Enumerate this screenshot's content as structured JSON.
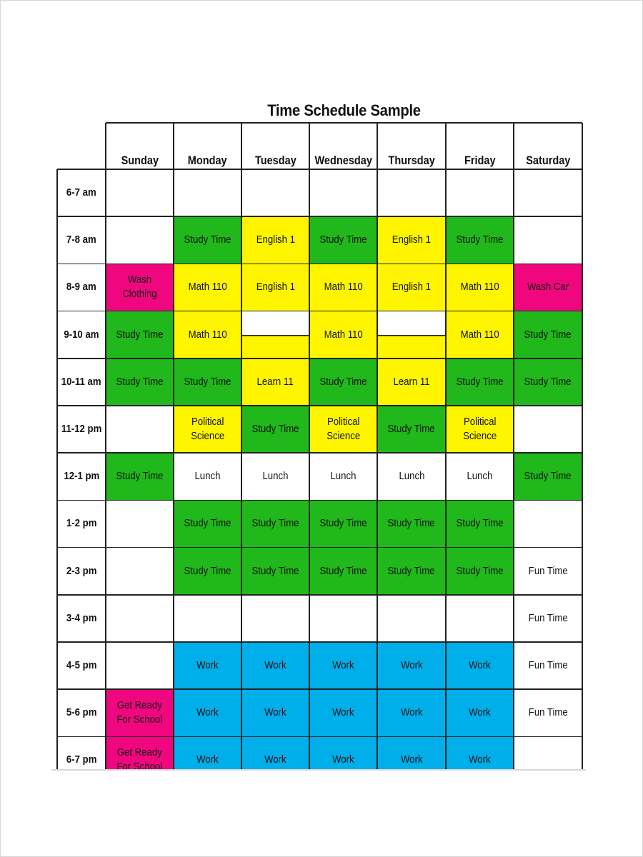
{
  "title": "Time Schedule Sample",
  "colors": {
    "study": "#20b81a",
    "class": "#fff500",
    "chore": "#f0077f",
    "work": "#00aeea",
    "free": "#ffffff"
  },
  "days": [
    "Sunday",
    "Monday",
    "Tuesday",
    "Wednesday",
    "Thursday",
    "Friday",
    "Saturday"
  ],
  "rows": [
    {
      "time": "6-7 am",
      "cells": [
        {
          "text": "",
          "type": "free"
        },
        {
          "text": "",
          "type": "free"
        },
        {
          "text": "",
          "type": "free"
        },
        {
          "text": "",
          "type": "free"
        },
        {
          "text": "",
          "type": "free"
        },
        {
          "text": "",
          "type": "free"
        },
        {
          "text": "",
          "type": "free"
        }
      ]
    },
    {
      "time": "7-8 am",
      "cells": [
        {
          "text": "",
          "type": "free"
        },
        {
          "text": "Study Time",
          "type": "study"
        },
        {
          "text": "English 1",
          "type": "class"
        },
        {
          "text": "Study Time",
          "type": "study"
        },
        {
          "text": "English 1",
          "type": "class"
        },
        {
          "text": "Study Time",
          "type": "study"
        },
        {
          "text": "",
          "type": "free"
        }
      ]
    },
    {
      "time": "8-9 am",
      "cells": [
        {
          "text": "Wash Clothing",
          "type": "chore"
        },
        {
          "text": "Math 110",
          "type": "class"
        },
        {
          "text": "English 1",
          "type": "class"
        },
        {
          "text": "Math 110",
          "type": "class"
        },
        {
          "text": "English 1",
          "type": "class"
        },
        {
          "text": "Math 110",
          "type": "class"
        },
        {
          "text": "Wash Car",
          "type": "chore"
        }
      ]
    },
    {
      "time": "9-10 am",
      "cells": [
        {
          "text": "Study Time",
          "type": "study"
        },
        {
          "text": "Math 110",
          "type": "class"
        },
        {
          "text": "",
          "type": "split"
        },
        {
          "text": "Math 110",
          "type": "class"
        },
        {
          "text": "",
          "type": "split"
        },
        {
          "text": "Math 110",
          "type": "class"
        },
        {
          "text": "Study Time",
          "type": "study"
        }
      ]
    },
    {
      "time": "10-11 am",
      "cells": [
        {
          "text": "Study Time",
          "type": "study"
        },
        {
          "text": "Study Time",
          "type": "study"
        },
        {
          "text": "Learn 11",
          "type": "class"
        },
        {
          "text": "Study Time",
          "type": "study"
        },
        {
          "text": "Learn 11",
          "type": "class"
        },
        {
          "text": "Study Time",
          "type": "study"
        },
        {
          "text": "Study Time",
          "type": "study"
        }
      ]
    },
    {
      "time": "11-12 pm",
      "cells": [
        {
          "text": "",
          "type": "free"
        },
        {
          "text": "Political\nScience",
          "type": "class"
        },
        {
          "text": "Study Time",
          "type": "study"
        },
        {
          "text": "Political\nScience",
          "type": "class"
        },
        {
          "text": "Study Time",
          "type": "study"
        },
        {
          "text": "Political\nScience",
          "type": "class"
        },
        {
          "text": "",
          "type": "free"
        }
      ]
    },
    {
      "time": "12-1 pm",
      "cells": [
        {
          "text": "Study Time",
          "type": "study"
        },
        {
          "text": "Lunch",
          "type": "free"
        },
        {
          "text": "Lunch",
          "type": "free"
        },
        {
          "text": "Lunch",
          "type": "free"
        },
        {
          "text": "Lunch",
          "type": "free"
        },
        {
          "text": "Lunch",
          "type": "free"
        },
        {
          "text": "Study Time",
          "type": "study"
        }
      ]
    },
    {
      "time": "1-2 pm",
      "cells": [
        {
          "text": "",
          "type": "free"
        },
        {
          "text": "Study Time",
          "type": "study"
        },
        {
          "text": "Study Time",
          "type": "study"
        },
        {
          "text": "Study Time",
          "type": "study"
        },
        {
          "text": "Study Time",
          "type": "study"
        },
        {
          "text": "Study Time",
          "type": "study"
        },
        {
          "text": "",
          "type": "free"
        }
      ]
    },
    {
      "time": "2-3 pm",
      "cells": [
        {
          "text": "",
          "type": "free"
        },
        {
          "text": "Study Time",
          "type": "study"
        },
        {
          "text": "Study Time",
          "type": "study"
        },
        {
          "text": "Study Time",
          "type": "study"
        },
        {
          "text": "Study Time",
          "type": "study"
        },
        {
          "text": "Study Time",
          "type": "study"
        },
        {
          "text": "Fun Time",
          "type": "free"
        }
      ]
    },
    {
      "time": "3-4 pm",
      "cells": [
        {
          "text": "",
          "type": "free"
        },
        {
          "text": "",
          "type": "free"
        },
        {
          "text": "",
          "type": "free"
        },
        {
          "text": "",
          "type": "free"
        },
        {
          "text": "",
          "type": "free"
        },
        {
          "text": "",
          "type": "free"
        },
        {
          "text": "Fun Time",
          "type": "free"
        }
      ]
    },
    {
      "time": "4-5 pm",
      "cells": [
        {
          "text": "",
          "type": "free"
        },
        {
          "text": "Work",
          "type": "work"
        },
        {
          "text": "Work",
          "type": "work"
        },
        {
          "text": "Work",
          "type": "work"
        },
        {
          "text": "Work",
          "type": "work"
        },
        {
          "text": "Work",
          "type": "work"
        },
        {
          "text": "Fun Time",
          "type": "free"
        }
      ]
    },
    {
      "time": "5-6 pm",
      "cells": [
        {
          "text": "Get Ready\nFor School",
          "type": "chore"
        },
        {
          "text": "Work",
          "type": "work"
        },
        {
          "text": "Work",
          "type": "work"
        },
        {
          "text": "Work",
          "type": "work"
        },
        {
          "text": "Work",
          "type": "work"
        },
        {
          "text": "Work",
          "type": "work"
        },
        {
          "text": "Fun Time",
          "type": "free"
        }
      ]
    },
    {
      "time": "6-7 pm",
      "cells": [
        {
          "text": "Get Ready\nFor School",
          "type": "chore"
        },
        {
          "text": "Work",
          "type": "work"
        },
        {
          "text": "Work",
          "type": "work"
        },
        {
          "text": "Work",
          "type": "work"
        },
        {
          "text": "Work",
          "type": "work"
        },
        {
          "text": "Work",
          "type": "work"
        },
        {
          "text": "",
          "type": "free"
        }
      ]
    }
  ]
}
